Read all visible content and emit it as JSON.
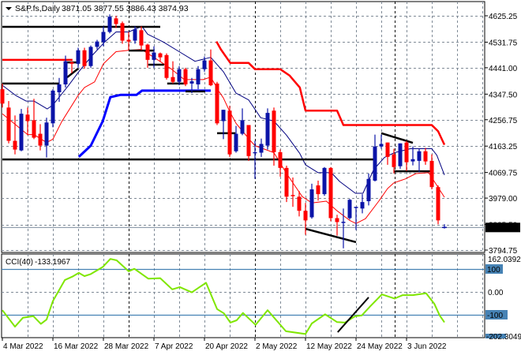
{
  "header": {
    "symbol": "S&P.fs,Daily",
    "ohlc_text": "3871.05 3877.55 3886.43 3874.93"
  },
  "colors": {
    "bull": "#0b14a8",
    "bear": "#ff0000",
    "ma_fast": "#ff0000",
    "ma_slow": "#000080",
    "support_line": "#0000ff",
    "resistance_line": "#ff0000",
    "drawings": "#000000",
    "cci": "#7fe600",
    "levels": "#4682b4",
    "grid": "#7f8a96"
  },
  "chart_data": [
    {
      "type": "candlestick",
      "title": "S&P.fs,Daily",
      "ylim": [
        3794.75,
        4625.25
      ],
      "y_ticks": [
        "4625.25",
        "4531.75",
        "4441.00",
        "4347.50",
        "4256.75",
        "4163.25",
        "4069.75",
        "3979.00",
        "3885.50",
        "3794.75"
      ],
      "x_tick_labels": [
        "4 Mar 2022",
        "16 Mar 2022",
        "28 Mar 2022",
        "7 Apr 2022",
        "20 Apr 2022",
        "2 May 2022",
        "12 May 2022",
        "24 May 2022",
        "3 Jun 2022"
      ],
      "x_tick_bar_index": [
        0,
        8,
        16,
        24,
        32,
        40,
        48,
        56,
        64
      ],
      "current_price": 3874.93,
      "current_price_label": "3874.93",
      "candles_ohlc": [
        [
          4365,
          4385,
          4300,
          4314
        ],
        [
          4300,
          4323,
          4173,
          4182
        ],
        [
          4182,
          4272,
          4134,
          4151
        ],
        [
          4148,
          4295,
          4145,
          4278
        ],
        [
          4275,
          4300,
          4202,
          4252
        ],
        [
          4255,
          4331,
          4188,
          4193
        ],
        [
          4207,
          4241,
          4148,
          4165
        ],
        [
          4165,
          4264,
          4123,
          4247
        ],
        [
          4244,
          4365,
          4230,
          4360
        ],
        [
          4354,
          4405,
          4320,
          4382
        ],
        [
          4382,
          4484,
          4371,
          4464
        ],
        [
          4461,
          4464,
          4422,
          4455
        ],
        [
          4455,
          4512,
          4441,
          4503
        ],
        [
          4503,
          4512,
          4438,
          4447
        ],
        [
          4447,
          4520,
          4441,
          4515
        ],
        [
          4515,
          4540,
          4506,
          4534
        ],
        [
          4532,
          4588,
          4517,
          4568
        ],
        [
          4568,
          4630,
          4563,
          4622
        ],
        [
          4616,
          4625,
          4582,
          4596
        ],
        [
          4599,
          4605,
          4526,
          4537
        ],
        [
          4540,
          4568,
          4503,
          4534
        ],
        [
          4537,
          4588,
          4526,
          4577
        ],
        [
          4574,
          4588,
          4503,
          4520
        ],
        [
          4523,
          4526,
          4441,
          4469
        ],
        [
          4469,
          4517,
          4441,
          4495
        ],
        [
          4492,
          4495,
          4464,
          4478
        ],
        [
          4486,
          4492,
          4399,
          4405
        ],
        [
          4408,
          4464,
          4385,
          4391
        ],
        [
          4391,
          4447,
          4379,
          4436
        ],
        [
          4436,
          4441,
          4376,
          4382
        ],
        [
          4385,
          4405,
          4351,
          4393
        ],
        [
          4382,
          4447,
          4365,
          4436
        ],
        [
          4436,
          4481,
          4427,
          4467
        ],
        [
          4467,
          4506,
          4376,
          4379
        ],
        [
          4385,
          4391,
          4238,
          4244
        ],
        [
          4252,
          4292,
          4188,
          4292
        ],
        [
          4289,
          4306,
          4125,
          4134
        ],
        [
          4145,
          4235,
          4140,
          4207
        ],
        [
          4207,
          4297,
          4202,
          4255
        ],
        [
          4238,
          4238,
          4111,
          4128
        ],
        [
          4139,
          4182,
          4047,
          4142
        ],
        [
          4140,
          4190,
          4125,
          4171
        ],
        [
          4165,
          4297,
          4151,
          4281
        ],
        [
          4289,
          4300,
          4094,
          4142
        ],
        [
          4142,
          4151,
          4055,
          4086
        ],
        [
          4086,
          4094,
          3965,
          3984
        ],
        [
          3990,
          4052,
          3948,
          3987
        ],
        [
          3984,
          4004,
          3914,
          3934
        ],
        [
          3934,
          3962,
          3849,
          3900
        ],
        [
          3911,
          4030,
          3906,
          4010
        ],
        [
          4024,
          4041,
          3970,
          3993
        ],
        [
          3993,
          4089,
          3987,
          4086
        ],
        [
          4086,
          4089,
          3897,
          3908
        ],
        [
          3908,
          3920,
          3846,
          3894
        ],
        [
          3892,
          3942,
          3801,
          3895
        ],
        [
          3908,
          3976,
          3903,
          3973
        ],
        [
          3945,
          3948,
          3866,
          3948
        ],
        [
          3942,
          3993,
          3925,
          3965
        ],
        [
          3968,
          4066,
          3953,
          4047
        ],
        [
          4041,
          4204,
          4038,
          4162
        ],
        [
          4162,
          4204,
          4154,
          4171
        ],
        [
          4176,
          4176,
          4097,
          4125
        ],
        [
          4134,
          4154,
          4066,
          4089
        ],
        [
          4092,
          4173,
          4083,
          4173
        ],
        [
          4176,
          4182,
          4075,
          4106
        ],
        [
          4109,
          4162,
          4095,
          4117
        ],
        [
          4111,
          4154,
          4072,
          4145
        ],
        [
          4145,
          4157,
          4097,
          4109
        ],
        [
          4111,
          4134,
          4010,
          4018
        ],
        [
          4018,
          4024,
          3886,
          3900
        ],
        [
          3871.05,
          3886.43,
          3871.05,
          3874.93
        ]
      ],
      "series": [
        {
          "name": "ma_fast",
          "points": [
            [
              0,
              4278
            ],
            [
              4,
              4204
            ],
            [
              5,
              4204
            ],
            [
              7,
              4176
            ],
            [
              8,
              4188
            ],
            [
              9.4,
              4250
            ],
            [
              12,
              4343
            ],
            [
              13,
              4371
            ],
            [
              14.6,
              4391
            ],
            [
              16,
              4455
            ],
            [
              18,
              4498
            ],
            [
              20,
              4503
            ],
            [
              22,
              4506
            ],
            [
              24,
              4478
            ],
            [
              26.8,
              4436
            ],
            [
              28.8,
              4399
            ],
            [
              31.8,
              4399
            ],
            [
              33,
              4408
            ],
            [
              34.3,
              4357
            ],
            [
              35,
              4334
            ],
            [
              36,
              4286
            ],
            [
              37,
              4244
            ],
            [
              39.3,
              4182
            ],
            [
              40,
              4165
            ],
            [
              43,
              4140
            ],
            [
              45,
              4066
            ],
            [
              47.5,
              3984
            ],
            [
              49,
              3962
            ],
            [
              51.3,
              3968
            ],
            [
              53,
              3934
            ],
            [
              55,
              3900
            ],
            [
              56,
              3889
            ],
            [
              57.5,
              3906
            ],
            [
              59.6,
              3968
            ],
            [
              61,
              4013
            ],
            [
              62,
              4033
            ],
            [
              63.8,
              4047
            ],
            [
              65.5,
              4066
            ],
            [
              67.5,
              4069
            ],
            [
              68.8,
              4024
            ],
            [
              70,
              3982
            ]
          ]
        },
        {
          "name": "ma_slow",
          "points": [
            [
              0,
              4379
            ],
            [
              2.1,
              4343
            ],
            [
              3.75,
              4323
            ],
            [
              5,
              4323
            ],
            [
              7.1,
              4295
            ],
            [
              8,
              4309
            ],
            [
              10.5,
              4379
            ],
            [
              12.1,
              4427
            ],
            [
              14.2,
              4484
            ],
            [
              16.2,
              4532
            ],
            [
              18,
              4568
            ],
            [
              20,
              4568
            ],
            [
              22.1,
              4588
            ],
            [
              23,
              4560
            ],
            [
              25.5,
              4532
            ],
            [
              28,
              4498
            ],
            [
              30.5,
              4464
            ],
            [
              32.5,
              4475
            ],
            [
              33,
              4478
            ],
            [
              35,
              4427
            ],
            [
              37,
              4351
            ],
            [
              39,
              4327
            ],
            [
              40.9,
              4264
            ],
            [
              43,
              4252
            ],
            [
              45,
              4202
            ],
            [
              47.1,
              4137
            ],
            [
              48,
              4097
            ],
            [
              50,
              4069
            ],
            [
              52.1,
              4069
            ],
            [
              53.4,
              4038
            ],
            [
              55.9,
              3996
            ],
            [
              57.1,
              3996
            ],
            [
              58.8,
              4080
            ],
            [
              60.5,
              4123
            ],
            [
              62.1,
              4140
            ],
            [
              64.6,
              4154
            ],
            [
              68,
              4154
            ],
            [
              68.8,
              4131
            ],
            [
              70,
              4061
            ]
          ]
        },
        {
          "name": "support_line",
          "points": [
            [
              12.1,
              4125
            ],
            [
              14,
              4165
            ],
            [
              15.9,
              4252
            ],
            [
              17.1,
              4337
            ],
            [
              18.75,
              4345
            ],
            [
              21.25,
              4345
            ],
            [
              22.1,
              4360
            ],
            [
              33,
              4360
            ]
          ]
        },
        {
          "name": "resistance_line_early",
          "points": [
            [
              0,
              4469
            ],
            [
              11.1,
              4469
            ]
          ]
        },
        {
          "name": "resistance_line",
          "points": [
            [
              33.9,
              4534
            ],
            [
              34.6,
              4506
            ],
            [
              36.1,
              4458
            ],
            [
              39,
              4458
            ],
            [
              40,
              4436
            ],
            [
              44,
              4436
            ],
            [
              45.5,
              4413
            ],
            [
              47.1,
              4371
            ],
            [
              48,
              4289
            ],
            [
              53,
              4289
            ],
            [
              54,
              4238
            ],
            [
              68,
              4238
            ],
            [
              69,
              4216
            ],
            [
              70,
              4168
            ]
          ]
        }
      ],
      "drawings": [
        [
          0,
          4586,
          25,
          4586
        ],
        [
          0,
          4385,
          9,
          4385
        ],
        [
          9.9,
          4460,
          12.1,
          4460
        ],
        [
          10.25,
          4407,
          12,
          4438
        ],
        [
          20,
          4502,
          24,
          4502
        ],
        [
          23.1,
          4452,
          25.6,
          4452
        ],
        [
          26.1,
          4385,
          29,
          4385
        ],
        [
          29,
          4357,
          32.1,
          4357
        ],
        [
          34,
          4209,
          36.9,
          4209
        ],
        [
          0,
          4116,
          59,
          4116
        ],
        [
          48,
          3870,
          56,
          3823
        ],
        [
          60,
          4209,
          65,
          4175
        ],
        [
          62,
          4074,
          67.75,
          4074
        ]
      ]
    },
    {
      "type": "line",
      "title": "CCI(40)",
      "title_value": "-133.1967",
      "ylim": [
        -202.3049,
        162.0392
      ],
      "y_tick_labels": {
        "max": "162.0392",
        "upper": "100",
        "zero": "0.00",
        "lower": "-100",
        "min": "-202.3049"
      },
      "levels": [
        100,
        -100
      ],
      "points": [
        [
          0,
          -80
        ],
        [
          2,
          -152
        ],
        [
          3.25,
          -113
        ],
        [
          4.9,
          -106
        ],
        [
          6.1,
          -140
        ],
        [
          7,
          -121
        ],
        [
          8,
          -40
        ],
        [
          9.9,
          52
        ],
        [
          11.1,
          67
        ],
        [
          12.1,
          83
        ],
        [
          13,
          69
        ],
        [
          14,
          78
        ],
        [
          15.9,
          109
        ],
        [
          17.1,
          144
        ],
        [
          18.1,
          138
        ],
        [
          20,
          90
        ],
        [
          20.9,
          101
        ],
        [
          23.1,
          58
        ],
        [
          25,
          60
        ],
        [
          26.9,
          11
        ],
        [
          28.1,
          21
        ],
        [
          30,
          -2
        ],
        [
          32.25,
          40
        ],
        [
          34,
          -75
        ],
        [
          35.1,
          -94
        ],
        [
          36.1,
          -134
        ],
        [
          37.1,
          -124
        ],
        [
          38.1,
          -92
        ],
        [
          40.1,
          -144
        ],
        [
          42,
          -80
        ],
        [
          44.9,
          -172
        ],
        [
          48,
          -184
        ],
        [
          49,
          -138
        ],
        [
          51.1,
          -98
        ],
        [
          53,
          -132
        ],
        [
          54.25,
          -134
        ],
        [
          55.9,
          -106
        ],
        [
          56.9,
          -103
        ],
        [
          58.25,
          -63
        ],
        [
          60.1,
          -11
        ],
        [
          62.1,
          -29
        ],
        [
          63.4,
          -14
        ],
        [
          65,
          -14
        ],
        [
          67.1,
          -6
        ],
        [
          68.4,
          -52
        ],
        [
          69.25,
          -103
        ],
        [
          70,
          -133.1967
        ]
      ],
      "drawings": [
        [
          53.1,
          -176,
          58,
          -24
        ]
      ]
    }
  ]
}
